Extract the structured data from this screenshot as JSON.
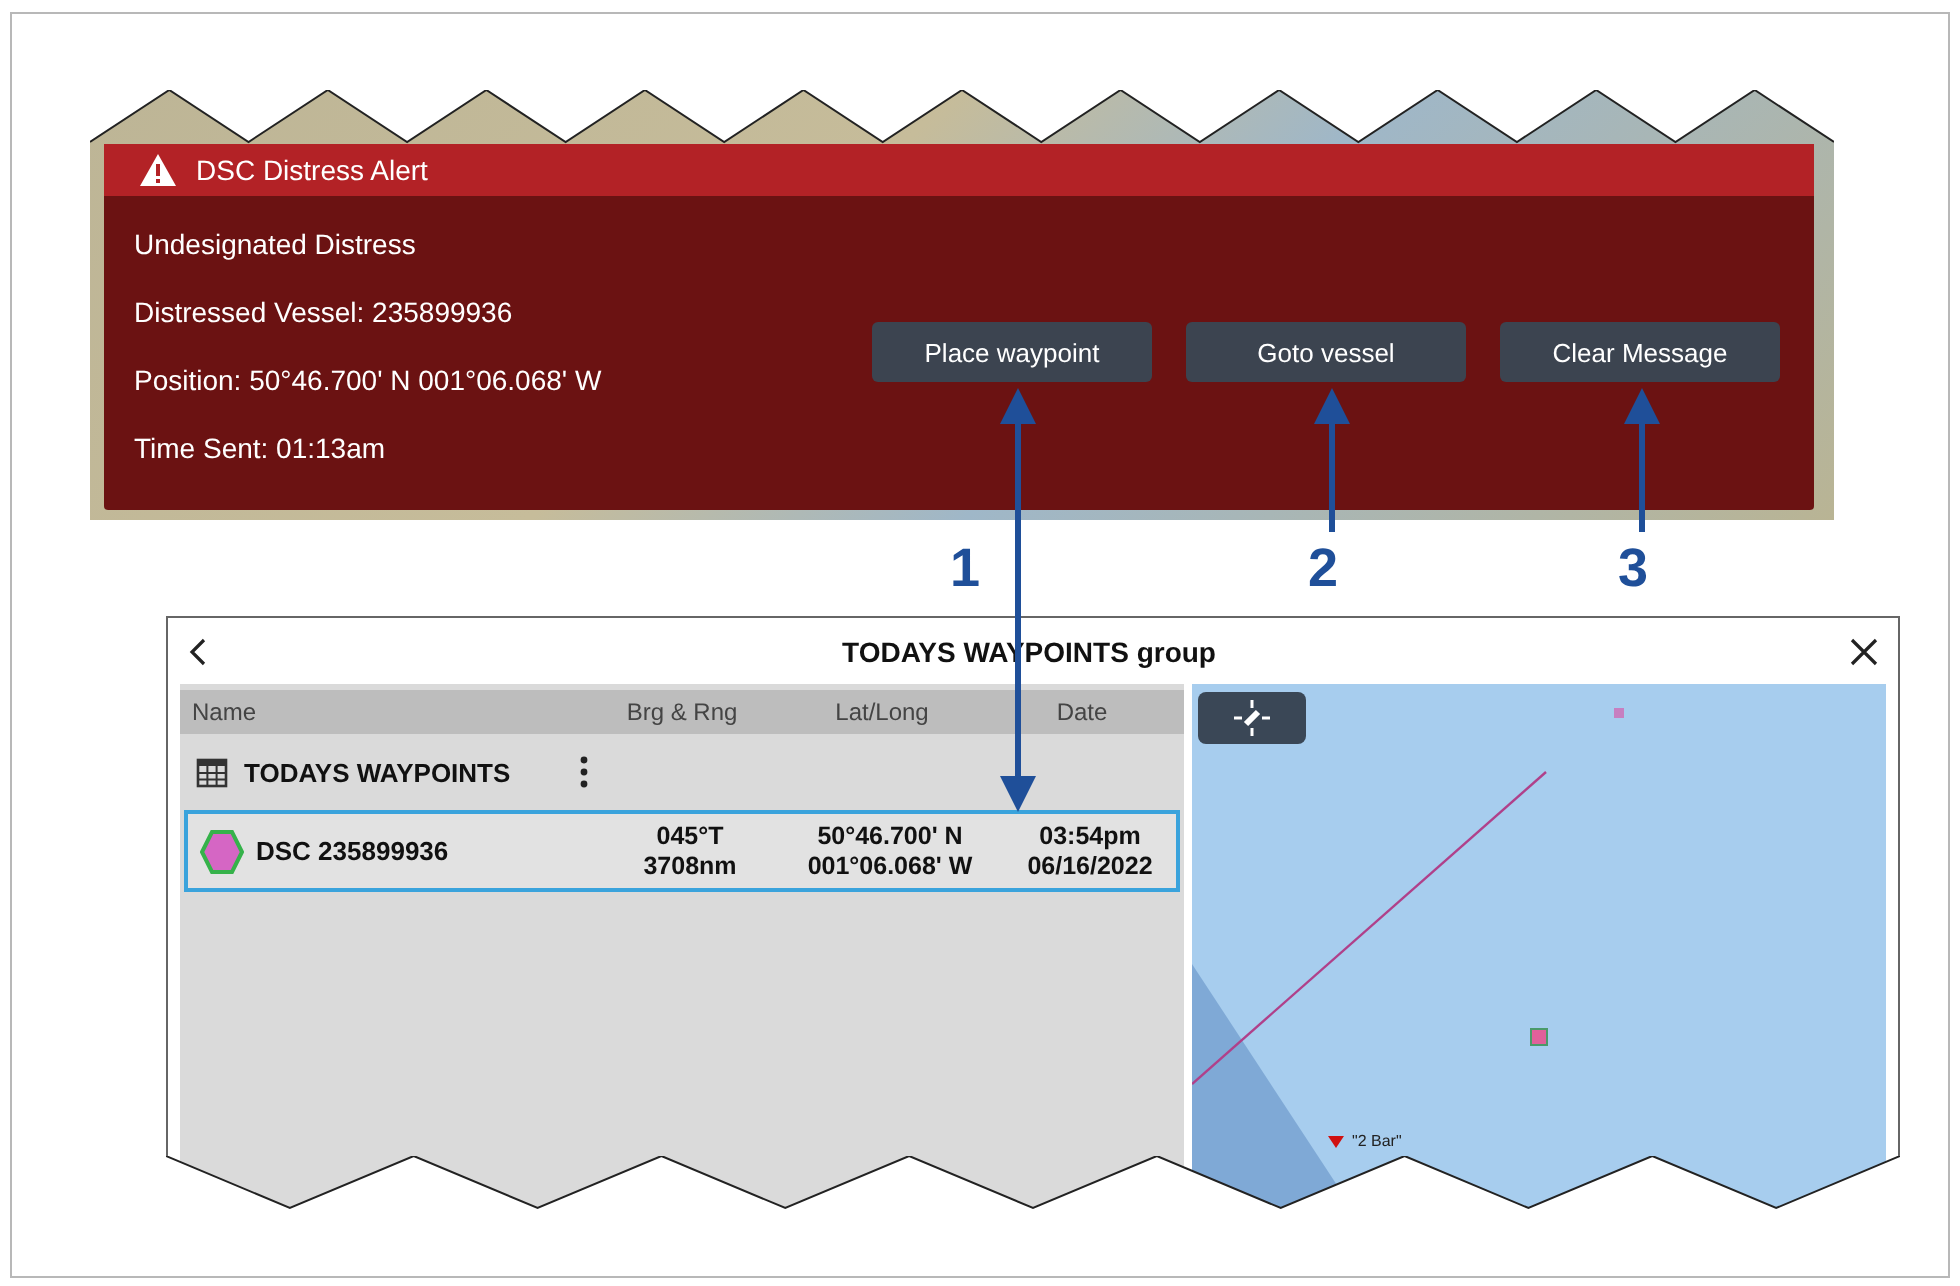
{
  "alert": {
    "title": "DSC Distress Alert",
    "lines": [
      "Undesignated Distress",
      "Distressed Vessel: 235899936",
      "Position: 50°46.700' N 001°06.068' W",
      "Time Sent: 01:13am"
    ],
    "buttons": [
      "Place waypoint",
      "Goto vessel",
      "Clear Message"
    ]
  },
  "callouts": [
    "1",
    "2",
    "3"
  ],
  "waypoints": {
    "title": "TODAYS WAYPOINTS group",
    "columns": [
      "Name",
      "Brg & Rng",
      "Lat/Long",
      "Date"
    ],
    "group": "TODAYS WAYPOINTS",
    "rows": [
      {
        "name": "DSC 235899936",
        "brg": "045°T",
        "rng": "3708nm",
        "lat": "50°46.700' N",
        "long": "001°06.068' W",
        "time": "03:54pm",
        "date": "06/16/2022",
        "selected": true
      }
    ],
    "map": {
      "label": "\"2 Bar\""
    }
  }
}
